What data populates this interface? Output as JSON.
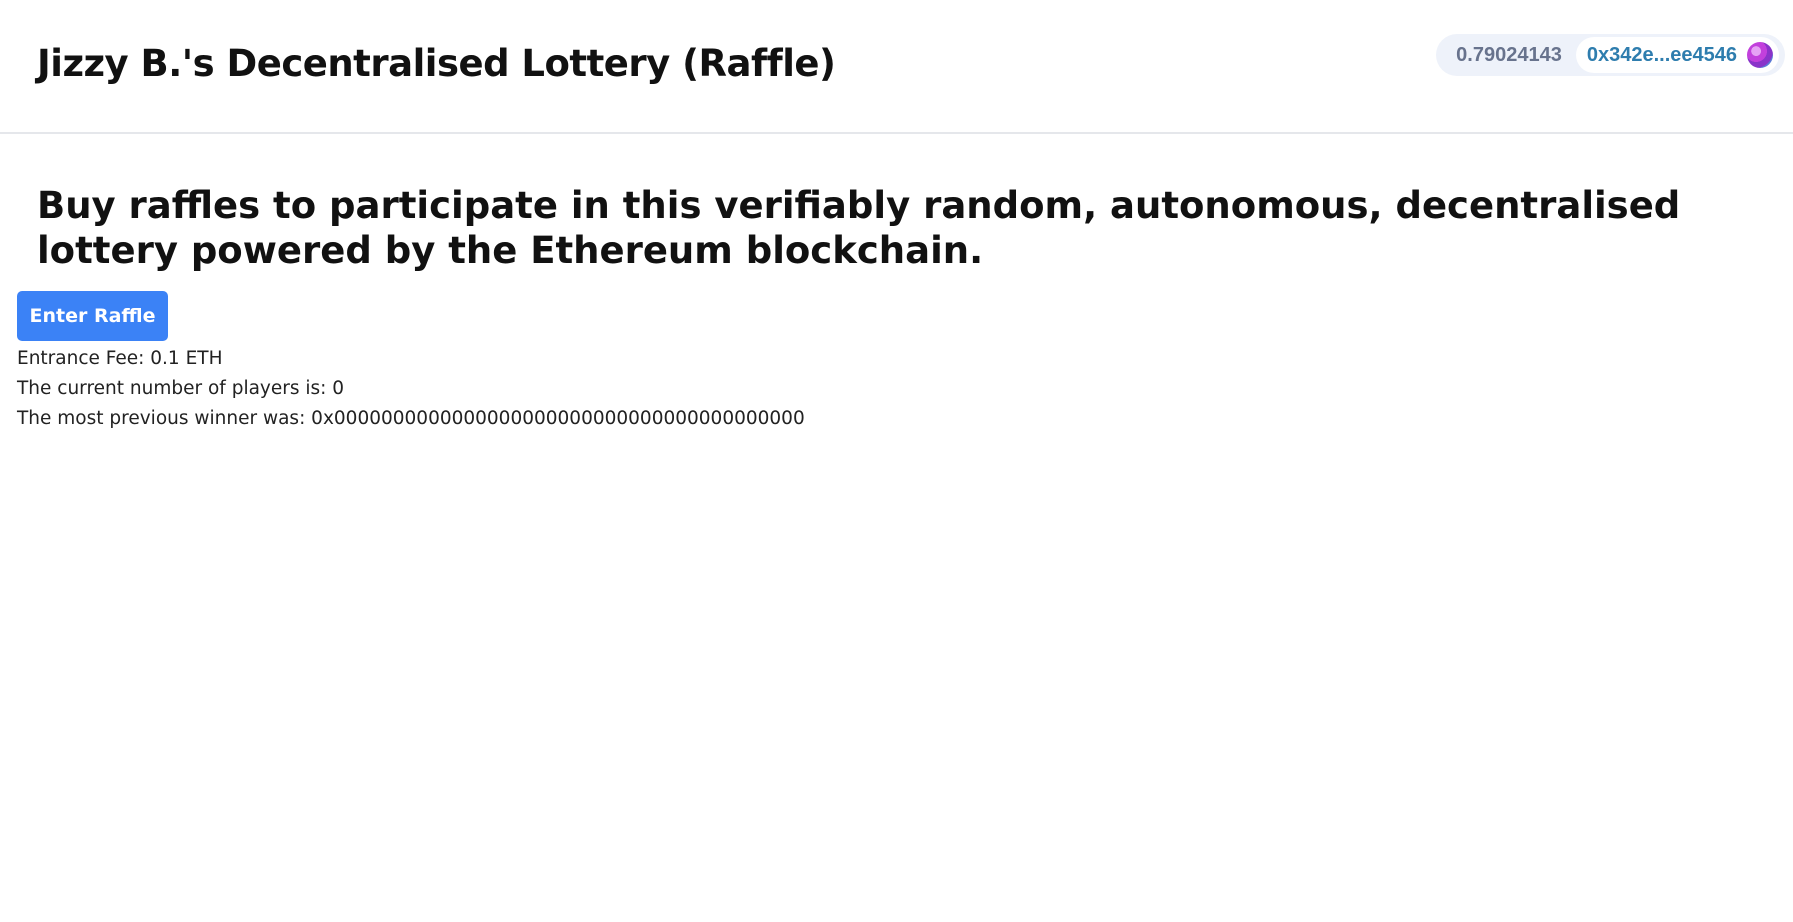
{
  "header": {
    "title": "Jizzy B.'s Decentralised Lottery (Raffle)",
    "wallet": {
      "balance": "0.79024143",
      "address": "0x342e...ee4546",
      "avatar_icon": "wallet-avatar-icon"
    }
  },
  "main": {
    "headline": "Buy raffles to participate in this verifiably random, autonomous, decentralised lottery powered by the Ethereum blockchain.",
    "enter_button_label": "Enter Raffle",
    "entrance_fee": "Entrance Fee: 0.1 ETH",
    "players": "The current number of players is: 0",
    "previous_winner": "The most previous winner was: 0x0000000000000000000000000000000000000000"
  },
  "colors": {
    "accent": "#3b82f6",
    "wallet_bg": "#eef2fa",
    "address_text": "#2e7dae",
    "balance_text": "#68738d"
  }
}
